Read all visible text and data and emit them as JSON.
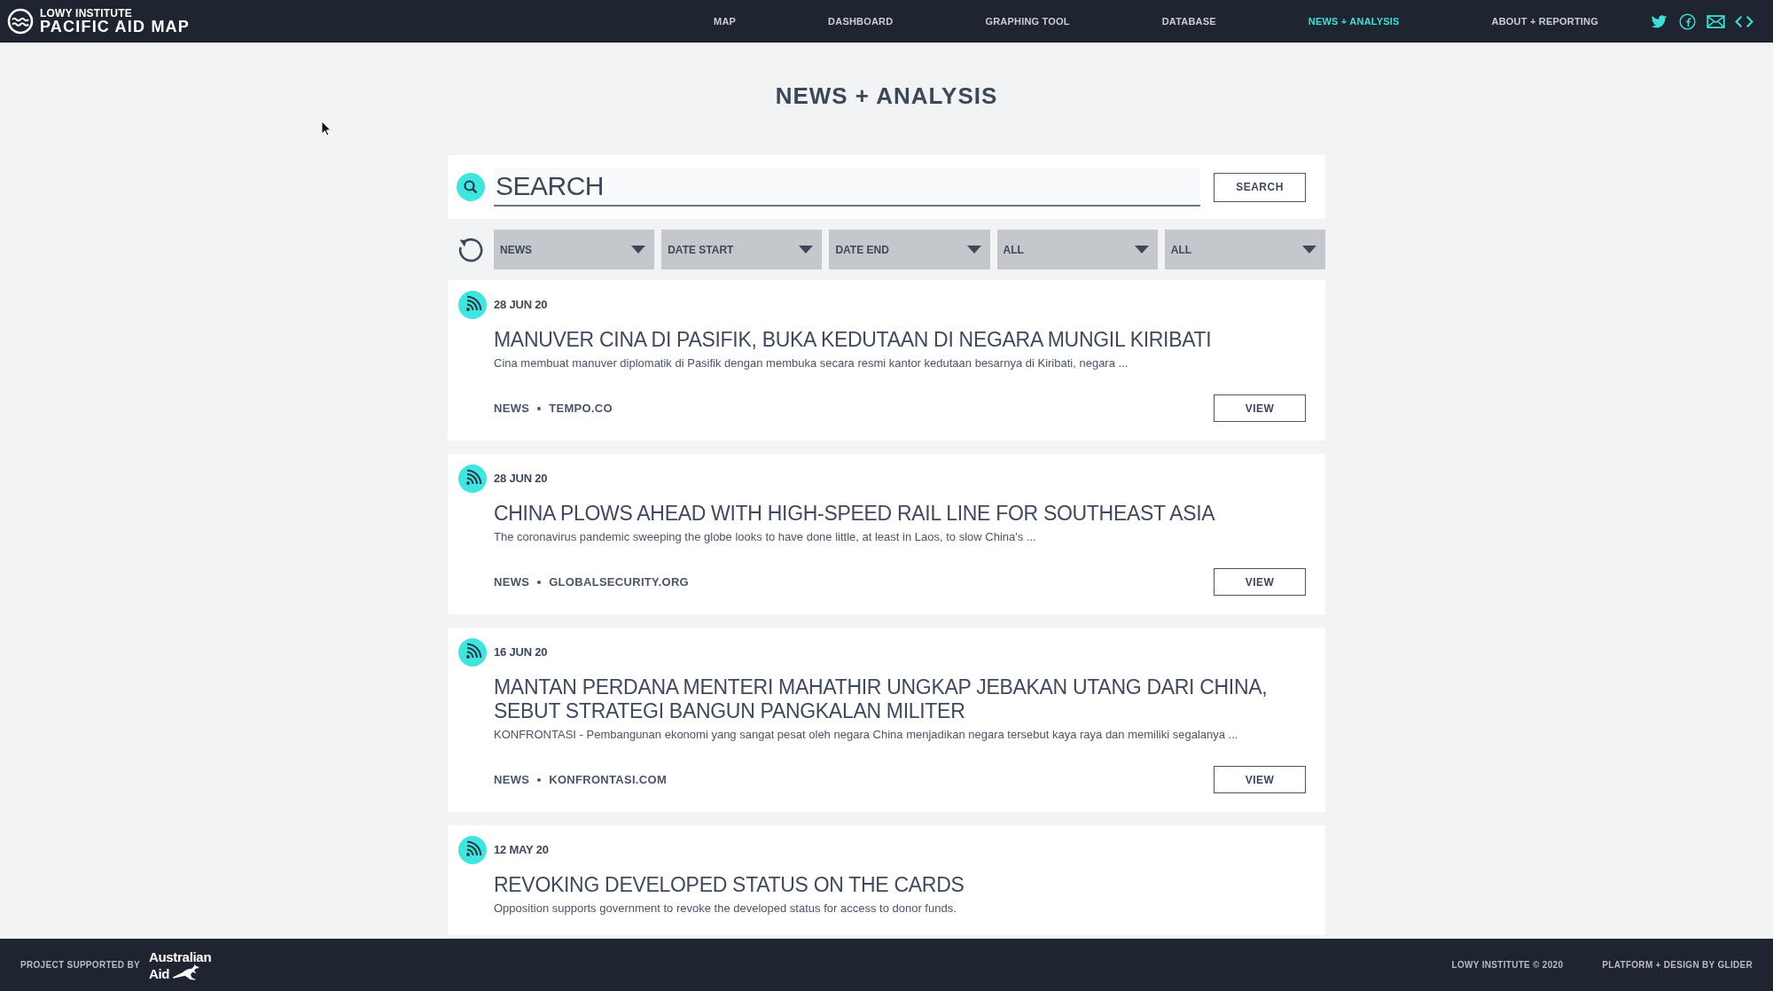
{
  "header": {
    "logo": {
      "organization": "LOWY INSTITUTE",
      "title": "PACIFIC AID MAP"
    },
    "nav": [
      {
        "label": "MAP",
        "selected": false
      },
      {
        "label": "DASHBOARD",
        "selected": false
      },
      {
        "label": "GRAPHING TOOL",
        "selected": false
      },
      {
        "label": "DATABASE",
        "selected": false
      },
      {
        "label": "NEWS + ANALYSIS",
        "selected": true
      },
      {
        "label": "ABOUT + REPORTING",
        "selected": false
      }
    ]
  },
  "page_title": "NEWS + ANALYSIS",
  "search": {
    "placeholder": "SEARCH",
    "button": "SEARCH"
  },
  "filters": [
    {
      "label": "NEWS"
    },
    {
      "label": "DATE START"
    },
    {
      "label": "DATE END"
    },
    {
      "label": "ALL"
    },
    {
      "label": "ALL"
    }
  ],
  "articles": [
    {
      "date": "28 JUN 20",
      "title": "MANUVER CINA DI PASIFIK, BUKA KEDUTAAN DI NEGARA MUNGIL KIRIBATI",
      "summary": "Cina membuat manuver diplomatik di Pasifik dengan membuka secara resmi kantor kedutaan besarnya di Kiribati, negara ...",
      "category": "NEWS",
      "source": "TEMPO.CO",
      "button": "VIEW"
    },
    {
      "date": "28 JUN 20",
      "title": "CHINA PLOWS AHEAD WITH HIGH-SPEED RAIL LINE FOR SOUTHEAST ASIA",
      "summary": "The coronavirus pandemic sweeping the globe looks to have done little, at least in Laos, to slow China's ...",
      "category": "NEWS",
      "source": "GLOBALSECURITY.ORG",
      "button": "VIEW"
    },
    {
      "date": "16 JUN 20",
      "title": "MANTAN PERDANA MENTERI MAHATHIR UNGKAP JEBAKAN UTANG DARI CHINA, SEBUT STRATEGI BANGUN PANGKALAN MILITER",
      "summary": "KONFRONTASI - Pembangunan ekonomi yang sangat pesat oleh negara China menjadikan negara tersebut kaya raya dan memiliki segalanya ...",
      "category": "NEWS",
      "source": "KONFRONTASI.COM",
      "button": "VIEW"
    },
    {
      "date": "12 MAY 20",
      "title": "REVOKING DEVELOPED STATUS ON THE CARDS",
      "summary": "Opposition supports government to revoke the developed status for access to donor funds."
    }
  ],
  "footer": {
    "supported_by": "PROJECT SUPPORTED BY",
    "sponsor_logo": {
      "line_1": "Australian",
      "line_2": "Aid"
    },
    "copyright": "LOWY INSTITUTE © 2020",
    "credit": "PLATFORM + DESIGN BY GLIDER"
  }
}
